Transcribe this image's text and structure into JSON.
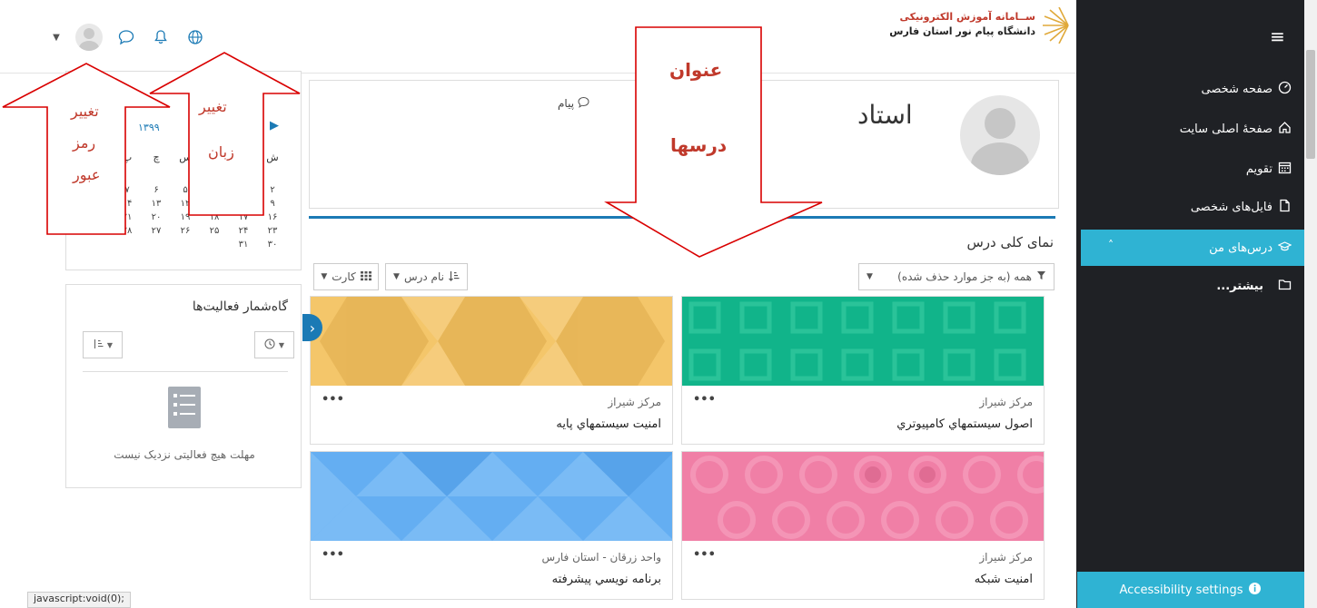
{
  "header": {
    "logo_line1": "ســامانه آموزش الکترونیکی",
    "logo_line2": "دانشگاه پیام نور استان فارس"
  },
  "sidebar": {
    "items": [
      {
        "label": "صفحه شخصی",
        "icon": "dashboard-icon"
      },
      {
        "label": "صفحهٔ اصلی سایت",
        "icon": "home-icon"
      },
      {
        "label": "تقویم",
        "icon": "calendar-icon"
      },
      {
        "label": "فایل‌های شخصی",
        "icon": "file-icon"
      },
      {
        "label": "درس‌های من",
        "icon": "graduation-cap-icon"
      },
      {
        "label": "بیشتر...",
        "icon": "folder-icon"
      }
    ],
    "accessibility_label": "Accessibility settings"
  },
  "profile": {
    "name": "استاد",
    "message_label": "پیام"
  },
  "overview": {
    "title": "نمای کلی درس",
    "filter_label": "همه (به جز موارد حذف شده)",
    "sort_label": "نام درس",
    "view_label": "کارت",
    "courses": [
      {
        "category": "مرکز شیراز",
        "name": "اصول سيستمهاي کامپيوتري",
        "color": "#11b48a"
      },
      {
        "category": "مرکز شیراز",
        "name": "امنيت سيستمهاي پايه",
        "color": "#f4c66a"
      },
      {
        "category": "مرکز شیراز",
        "name": "امنيت شبکه",
        "color": "#f07fa6"
      },
      {
        "category": "واحد زرقان - استان فارس",
        "name": "برنامه نويسي پيشرفته",
        "color": "#64aef2"
      }
    ]
  },
  "calendar": {
    "month": "۱۳۹۹",
    "weekdays": [
      "ش",
      "ی",
      "د",
      "س",
      "چ",
      "پ",
      "ج"
    ],
    "days": [
      "",
      "",
      "",
      "",
      "",
      "",
      "",
      "۲",
      "۳",
      "۴",
      "۵",
      "۶",
      "۷",
      "۸",
      "۹",
      "۱۰",
      "۱۱",
      "۱۲",
      "۱۳",
      "۱۴",
      "۱۵",
      "۱۶",
      "۱۷",
      "۱۸",
      "۱۹",
      "۲۰",
      "۲۱",
      "۲۲",
      "۲۳",
      "۲۴",
      "۲۵",
      "۲۶",
      "۲۷",
      "۲۸",
      "۲۹",
      "۳۰",
      "۳۱",
      "",
      "",
      "",
      "",
      ""
    ]
  },
  "timeline": {
    "title": "گاه‌شمار فعالیت‌ها",
    "empty_text": "مهلت هیچ فعالیتی نزدیک نیست"
  },
  "annotations": {
    "change_password": [
      "تغییر",
      "رمز",
      "عبور"
    ],
    "change_language": [
      "تغییر",
      "زبان"
    ],
    "course_titles": [
      "عنوان",
      "درسها"
    ]
  },
  "status_url": "javascript:void(0);",
  "colors": {
    "sidebar_bg": "#1f2125",
    "accent": "#2fb3d3",
    "primary": "#1b7ab5",
    "annotation": "#c0392b"
  }
}
